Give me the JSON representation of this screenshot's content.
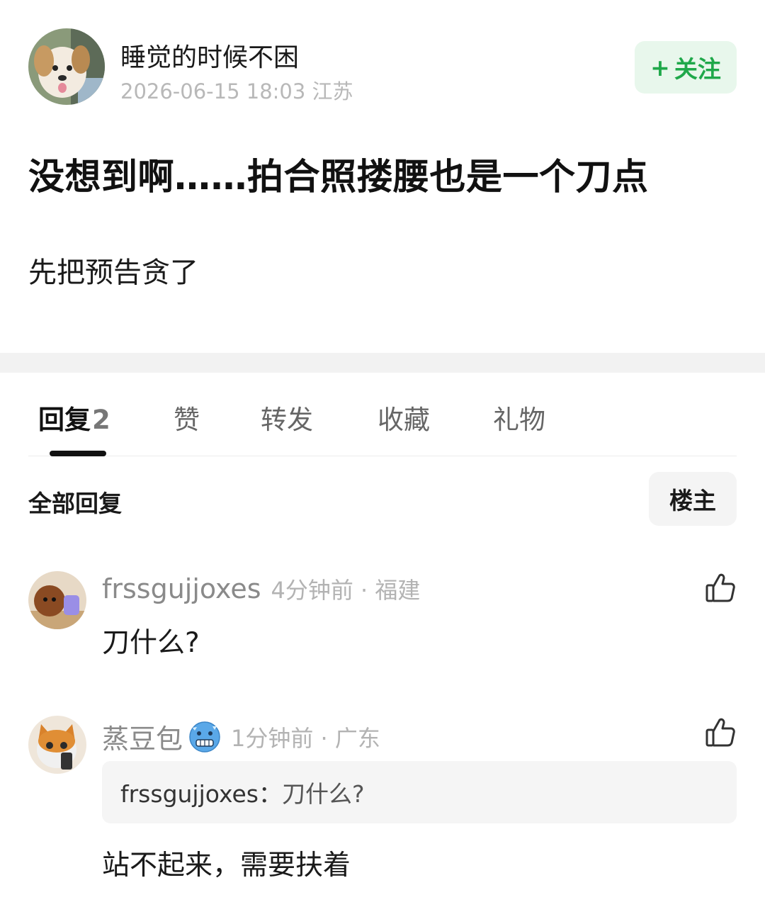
{
  "post": {
    "author": "睡觉的时候不困",
    "meta": "2026-06-15 18:03 江苏",
    "follow_label": "关注",
    "title": "没想到啊……拍合照搂腰也是一个刀点",
    "body": "先把预告贪了"
  },
  "tabs": {
    "replies_label": "回复",
    "replies_count": "2",
    "likes_label": "赞",
    "reposts_label": "转发",
    "favorites_label": "收藏",
    "gifts_label": "礼物"
  },
  "replies_header": {
    "title": "全部回复",
    "op_filter_label": "楼主"
  },
  "comments": [
    {
      "user": "frssgujjoxes",
      "meta": "4分钟前 · 福建",
      "text": "刀什么?"
    },
    {
      "user": "蒸豆包",
      "emoji": "cold-face-emoji",
      "meta": "1分钟前 · 广东",
      "quote_user": "frssgujjoxes：",
      "quote_text": "刀什么?",
      "text": "站不起来，需要扶着"
    }
  ],
  "colors": {
    "follow_bg": "#e8f7ec",
    "follow_text": "#1fa84a",
    "meta_text": "#b3b3b3",
    "divider": "#f2f2f2"
  }
}
